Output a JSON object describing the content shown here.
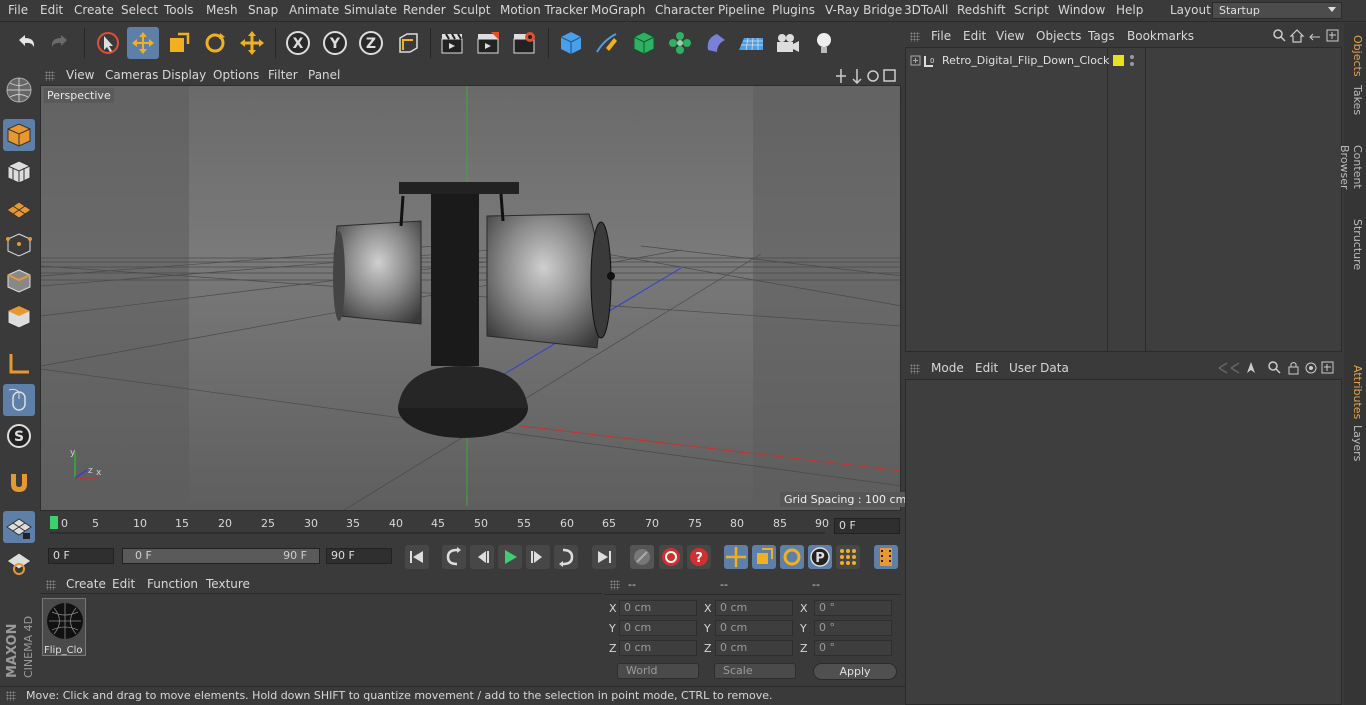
{
  "menu": [
    "File",
    "Edit",
    "Create",
    "Select",
    "Tools",
    "Mesh",
    "Snap",
    "Animate",
    "Simulate",
    "Render",
    "Sculpt",
    "Motion Tracker",
    "MoGraph",
    "Character",
    "Pipeline",
    "Plugins",
    "V-Ray Bridge",
    "3DToAll",
    "Redshift",
    "Script",
    "Window",
    "Help"
  ],
  "layout": {
    "label": "Layout:",
    "value": "Startup"
  },
  "viewport": {
    "menu": [
      "View",
      "Cameras",
      "Display",
      "Options",
      "Filter",
      "Panel"
    ],
    "camera_label": "Perspective",
    "grid_spacing": "Grid Spacing : 100 cm",
    "axis_x": "x",
    "axis_y": "y",
    "axis_z": "z"
  },
  "timeline": {
    "ticks": [
      "0",
      "5",
      "10",
      "15",
      "20",
      "25",
      "30",
      "35",
      "40",
      "45",
      "50",
      "55",
      "60",
      "65",
      "70",
      "75",
      "80",
      "85",
      "90"
    ],
    "current_frame": "0 F",
    "start_field": "0 F",
    "range_start": "0 F",
    "range_end": "90 F",
    "end_field": "90 F"
  },
  "material_menu": [
    "Create",
    "Edit",
    "Function",
    "Texture"
  ],
  "material": {
    "name": "Flip_Clo"
  },
  "coords": {
    "headers": [
      "--",
      "--",
      "--"
    ],
    "rows": [
      {
        "a": "X",
        "pos": "0 cm",
        "b": "X",
        "size": "0 cm",
        "c": "X",
        "rot": "0 °"
      },
      {
        "a": "Y",
        "pos": "0 cm",
        "b": "Y",
        "size": "0 cm",
        "c": "Y",
        "rot": "0 °"
      },
      {
        "a": "Z",
        "pos": "0 cm",
        "b": "Z",
        "size": "0 cm",
        "c": "Z",
        "rot": "0 °"
      }
    ],
    "world": "World",
    "scale": "Scale",
    "apply": "Apply"
  },
  "status": "Move: Click and drag to move elements. Hold down SHIFT to quantize movement / add to the selection in point mode, CTRL to remove.",
  "objects": {
    "menu": [
      "File",
      "Edit",
      "View",
      "Objects",
      "Tags",
      "Bookmarks"
    ],
    "items": [
      {
        "name": "Retro_Digital_Flip_Down_Clock"
      }
    ],
    "tag_color": "#e8e020"
  },
  "attributes": {
    "menu": [
      "Mode",
      "Edit",
      "User Data"
    ]
  },
  "right_tabs": [
    "Objects",
    "Takes",
    "Content Browser",
    "Structure",
    "Attributes",
    "Layers"
  ],
  "logo": {
    "brand": "MAXON",
    "product": "CINEMA 4D"
  },
  "colors": {
    "accent": "#5e7fa8",
    "x_axis": "#c83030",
    "y_axis": "#30b030",
    "z_axis": "#3040d0"
  }
}
